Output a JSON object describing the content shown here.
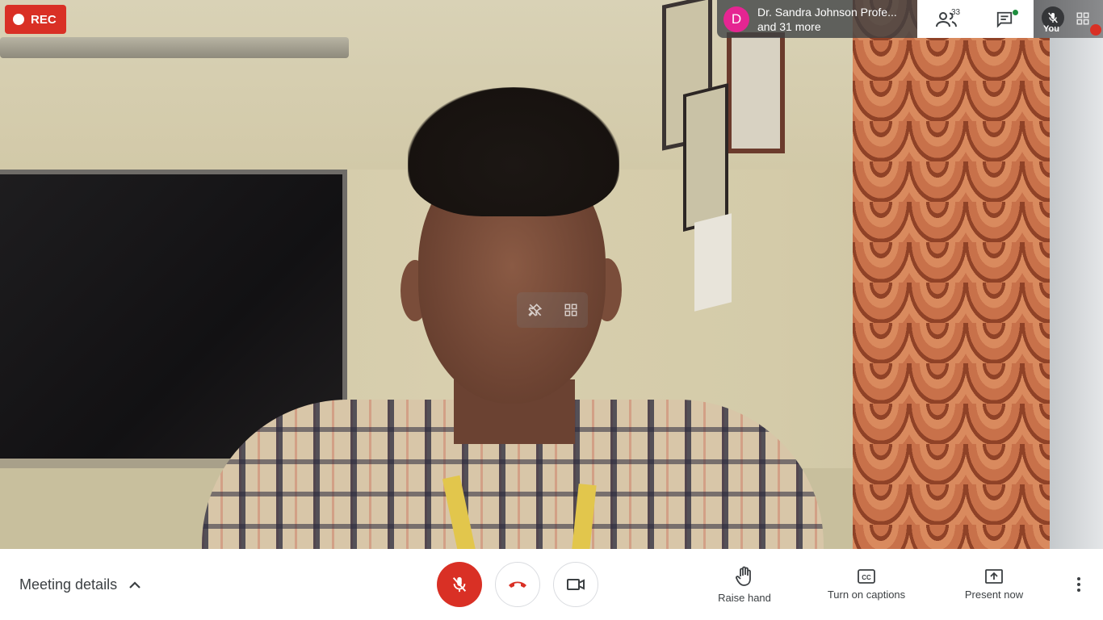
{
  "recording": {
    "label": "REC"
  },
  "presenter": {
    "avatar_letter": "D",
    "name": "Dr. Sandra Johnson Profe...",
    "more": "and 31 more"
  },
  "toolbar_top": {
    "people_count": "33",
    "people_icon": "people-icon",
    "chat_icon": "chat-icon"
  },
  "self_tile": {
    "label": "You"
  },
  "bottom": {
    "meeting_details": "Meeting details",
    "raise_hand": "Raise hand",
    "captions": "Turn on captions",
    "present": "Present now"
  },
  "colors": {
    "rec": "#d93025",
    "avatar": "#e52592",
    "mic_off": "#d93025",
    "end_call": "#d93025",
    "chat_badge": "#1e8e3e"
  }
}
